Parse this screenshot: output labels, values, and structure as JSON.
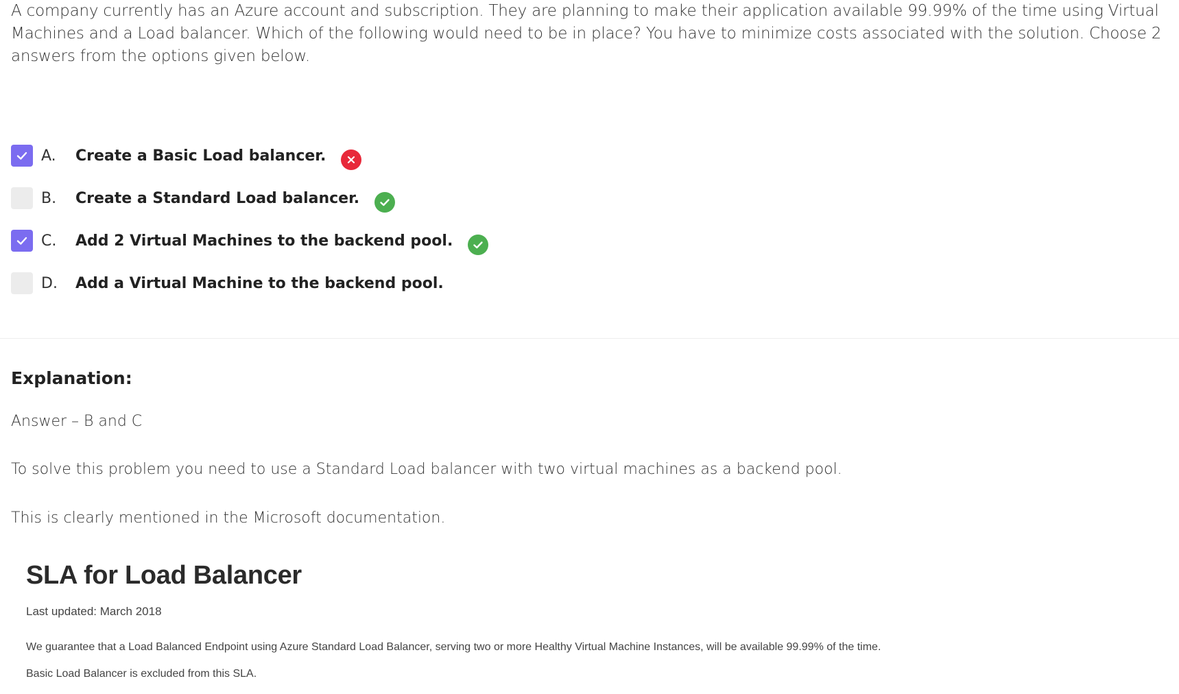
{
  "question": {
    "text": "A company currently has an Azure account and subscription. They are planning to make their application available 99.99% of the time using Virtual Machines and a Load balancer. Which of the following would need to be in place? You have to minimize costs associated with the solution. Choose 2 answers from the options given below."
  },
  "options": [
    {
      "letter": "A.",
      "text": "Create a Basic Load balancer.",
      "checked": true,
      "result": "wrong",
      "result_icon": "x-circle-icon"
    },
    {
      "letter": "B.",
      "text": "Create a Standard Load balancer.",
      "checked": false,
      "result": "correct",
      "result_icon": "check-circle-icon"
    },
    {
      "letter": "C.",
      "text": "Add 2 Virtual Machines to the backend pool.",
      "checked": true,
      "result": "correct",
      "result_icon": "check-circle-icon"
    },
    {
      "letter": "D.",
      "text": "Add a Virtual Machine to the backend pool.",
      "checked": false,
      "result": "none"
    }
  ],
  "explanation": {
    "heading": "Explanation:",
    "answer": "Answer – B and C",
    "line1": "To solve this problem you need to use a Standard Load balancer with two virtual machines as a backend pool.",
    "line2": "This is clearly mentioned in the Microsoft documentation."
  },
  "doc_excerpt": {
    "title": "SLA for Load Balancer",
    "updated": "Last updated: March 2018",
    "para1": "We guarantee that a Load Balanced Endpoint using Azure Standard Load Balancer, serving two or more Healthy Virtual Machine Instances, will be available 99.99% of the time.",
    "para2": "Basic Load Balancer is excluded from this SLA."
  },
  "colors": {
    "checkbox_checked": "#7b6cf0",
    "checkbox_unchecked": "#ececec",
    "wrong": "#e8293a",
    "correct": "#4caf50"
  }
}
